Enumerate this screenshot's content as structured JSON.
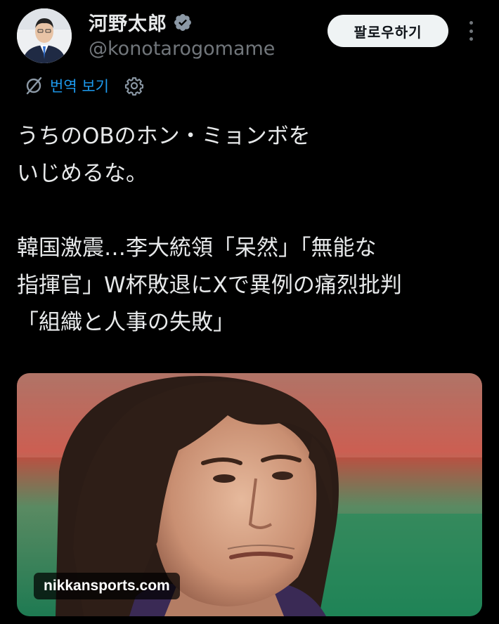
{
  "author": {
    "display_name": "河野太郎",
    "handle": "@konotarogomame",
    "verified_icon": "verified-badge-icon",
    "avatar_icon": "profile-photo"
  },
  "header": {
    "follow_label": "팔로우하기",
    "more_icon": "more-vertical-icon"
  },
  "translate": {
    "label": "번역 보기",
    "icon": "translate-icon",
    "settings_icon": "gear-icon",
    "color": "#1d9bf0"
  },
  "tweet": {
    "text": "うちのOBのホン・ミョンボを\nいじめるな。\n\n韓国激震…李大統領「呆然」「無能な\n指揮官」W杯敗退にXで異例の痛烈批判\n「組織と人事の失敗」"
  },
  "media": {
    "source": "nikkansports.com"
  },
  "colors": {
    "background": "#000000",
    "text": "#e7e9ea",
    "secondary": "#71767b",
    "accent": "#1d9bf0"
  }
}
